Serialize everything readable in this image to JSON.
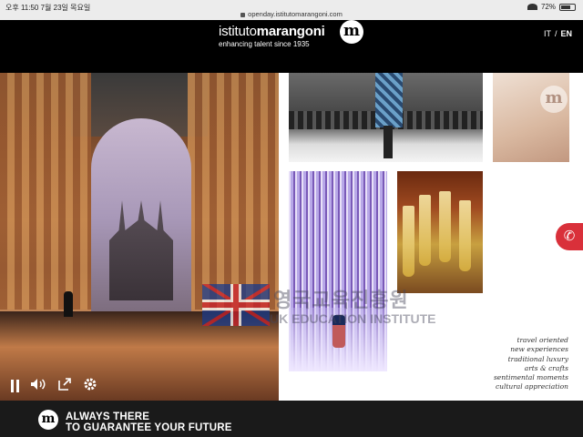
{
  "status_bar": {
    "time": "오후 11:50  7월 23일 목요일",
    "url": "openday.istitutomarangoni.com",
    "battery": "72%",
    "battery_level": 0.72
  },
  "header": {
    "brand_prefix": "istituto",
    "brand_bold": "marangoni",
    "tagline": "enhancing talent since 1935",
    "logo_letter": "m",
    "lang_it": "IT",
    "lang_sep": "/",
    "lang_en": "EN"
  },
  "watermark": {
    "korean": "영국교육진흥원",
    "english": "UK EDUCATION INSTITUTE"
  },
  "video_controls": [
    "pause-icon",
    "volume-icon",
    "fullscreen-icon",
    "settings-icon"
  ],
  "values_list": [
    "travel oriented",
    "new experiences",
    "traditional luxury",
    "arts & crafts",
    "sentimental moments",
    "cultural appreciation"
  ],
  "footer": {
    "logo_letter": "m",
    "line1": "ALWAYS THERE",
    "line2": "TO GUARANTEE YOUR FUTURE"
  },
  "colors": {
    "header_bg": "#000000",
    "footer_bg": "#1a1a1a",
    "phone_button": "#d9303a"
  }
}
